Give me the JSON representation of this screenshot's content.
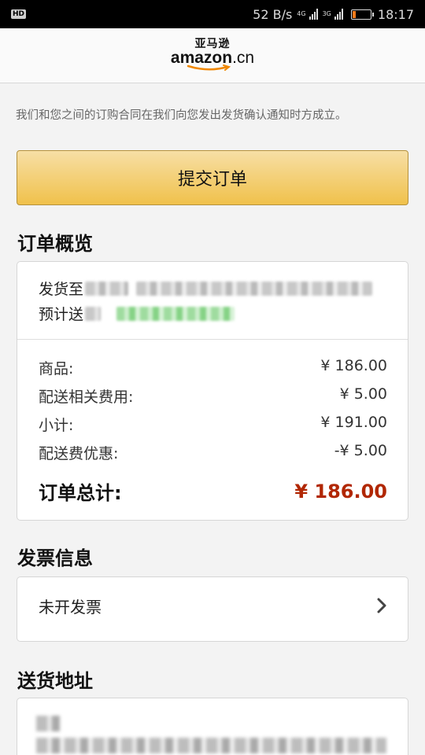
{
  "status_bar": {
    "hd_badge": "HD",
    "speed": "52 B/s",
    "net1": "4G",
    "net2": "3G",
    "battery_level": 0.2,
    "battery_color": "#f27a1a",
    "time": "18:17"
  },
  "header": {
    "logo_cn": "亚马逊",
    "logo_en": "amazon",
    "logo_tld": ".cn"
  },
  "notice": "我们和您之间的订购合同在我们向您发出发货确认通知时方成立。",
  "submit_button": "提交订单",
  "order_summary": {
    "title": "订单概览",
    "ship_to_label": "发货至",
    "eta_label": "预计送",
    "items_label": "商品:",
    "items_value": "¥ 186.00",
    "shipping_label": "配送相关费用:",
    "shipping_value": "¥ 5.00",
    "subtotal_label": "小计:",
    "subtotal_value": "¥ 191.00",
    "discount_label": "配送费优惠:",
    "discount_value": "-¥ 5.00",
    "total_label": "订单总计:",
    "total_value": "¥ 186.00",
    "total_color": "#b12704"
  },
  "invoice": {
    "title": "发票信息",
    "value": "未开发票"
  },
  "address": {
    "title": "送货地址"
  },
  "colors": {
    "button_top": "#f7dfa5",
    "button_bottom": "#f0c14b",
    "logo_smile": "#f08804"
  }
}
